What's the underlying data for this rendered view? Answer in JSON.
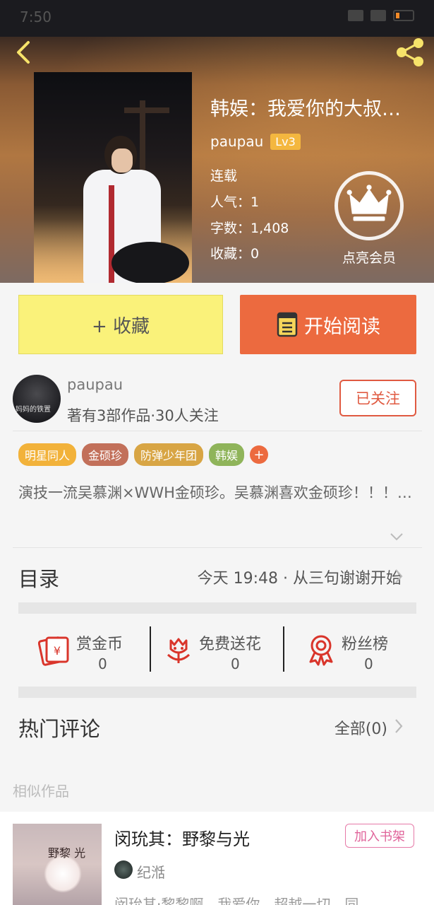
{
  "status": {
    "time": "7:50"
  },
  "book": {
    "title": "韩娱：我爱你的大叔…",
    "author": "paupau",
    "level": "Lv3",
    "status": "连载",
    "popularity": "人气：1",
    "words": "字数：1,408",
    "collections": "收藏：0",
    "vip_label": "点亮会员"
  },
  "actions": {
    "favorite": "+ 收藏",
    "read": "开始阅读"
  },
  "author_block": {
    "avatar_text": "妈妈的铁置",
    "name": "paupau",
    "meta": "著有3部作品·30人关注",
    "follow": "已关注"
  },
  "tags": [
    {
      "label": "明星同人",
      "color": "#f2b23a"
    },
    {
      "label": "金硕珍",
      "color": "#c2705a"
    },
    {
      "label": "防弹少年团",
      "color": "#d8a544"
    },
    {
      "label": "韩娱",
      "color": "#8fb45a"
    }
  ],
  "tag_add": "+",
  "description": "演技一流吴慕渊×WWH金硕珍。吴慕渊喜欢金硕珍！！！…",
  "catalog": {
    "title": "目录",
    "latest": "今天 19:48 · 从三句谢谢开始"
  },
  "stats": [
    {
      "label": "赏金币",
      "value": "0"
    },
    {
      "label": "免费送花",
      "value": "0"
    },
    {
      "label": "粉丝榜",
      "value": "0"
    }
  ],
  "comments": {
    "title": "热门评论",
    "all": "全部(0)"
  },
  "similar": {
    "section_label": "相似作品",
    "cover_text": "野黎 光",
    "title": "闵玧其：野黎与光",
    "shelf_button": "加入书架",
    "author": "纪湉",
    "tags": "闵玧其·黎黎啊　我爱你　超越一切　同"
  },
  "colors": {
    "accent": "#ec6a3f",
    "favorite_bg": "#faf27a",
    "follow": "#e05a41",
    "level_badge": "#f4b73f",
    "shelf": "#e0649a"
  }
}
